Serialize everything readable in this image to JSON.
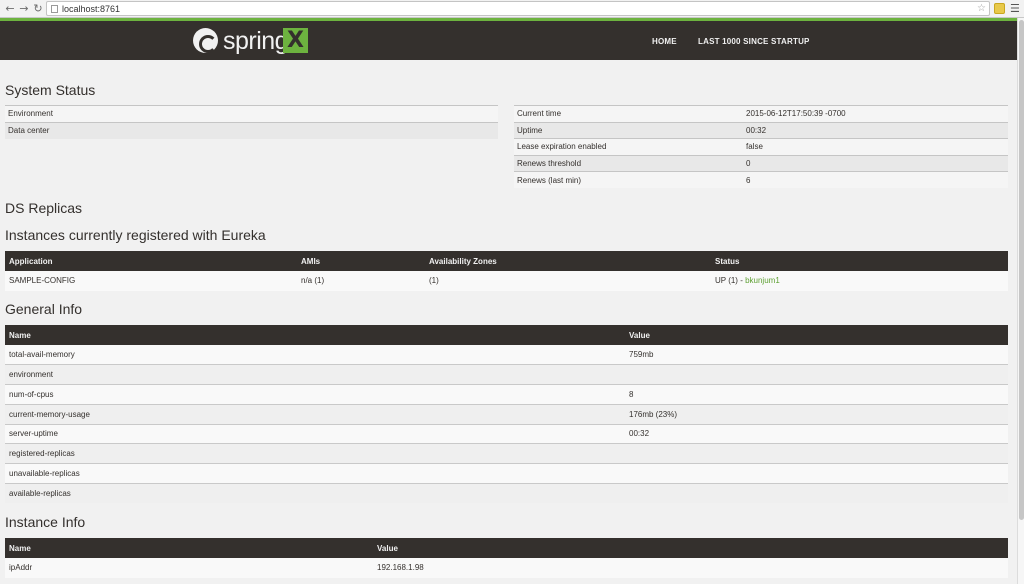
{
  "browser": {
    "url": "localhost:8761"
  },
  "header": {
    "logo_text": "spring",
    "logo_mark": "X",
    "nav": [
      {
        "label": "HOME"
      },
      {
        "label": "LAST 1000 SINCE STARTUP"
      }
    ]
  },
  "system_status": {
    "title": "System Status",
    "left": [
      {
        "key": "Environment",
        "value": ""
      },
      {
        "key": "Data center",
        "value": ""
      }
    ],
    "right": [
      {
        "key": "Current time",
        "value": "2015-06-12T17:50:39 -0700"
      },
      {
        "key": "Uptime",
        "value": "00:32"
      },
      {
        "key": "Lease expiration enabled",
        "value": "false"
      },
      {
        "key": "Renews threshold",
        "value": "0"
      },
      {
        "key": "Renews (last min)",
        "value": "6"
      }
    ]
  },
  "ds_replicas": {
    "title": "DS Replicas"
  },
  "instances": {
    "title": "Instances currently registered with Eureka",
    "columns": [
      "Application",
      "AMIs",
      "Availability Zones",
      "Status"
    ],
    "rows": [
      {
        "application": "SAMPLE-CONFIG",
        "amis": "n/a (1)",
        "zones": "(1)",
        "status": "UP (1) - ",
        "status_link": "bkunjum1"
      }
    ]
  },
  "general_info": {
    "title": "General Info",
    "columns": [
      "Name",
      "Value"
    ],
    "rows": [
      {
        "name": "total-avail-memory",
        "value": "759mb"
      },
      {
        "name": "environment",
        "value": ""
      },
      {
        "name": "num-of-cpus",
        "value": "8"
      },
      {
        "name": "current-memory-usage",
        "value": "176mb (23%)"
      },
      {
        "name": "server-uptime",
        "value": "00:32"
      },
      {
        "name": "registered-replicas",
        "value": ""
      },
      {
        "name": "unavailable-replicas",
        "value": ""
      },
      {
        "name": "available-replicas",
        "value": ""
      }
    ]
  },
  "instance_info": {
    "title": "Instance Info",
    "columns": [
      "Name",
      "Value"
    ],
    "rows": [
      {
        "name": "ipAddr",
        "value": "192.168.1.98"
      }
    ]
  }
}
